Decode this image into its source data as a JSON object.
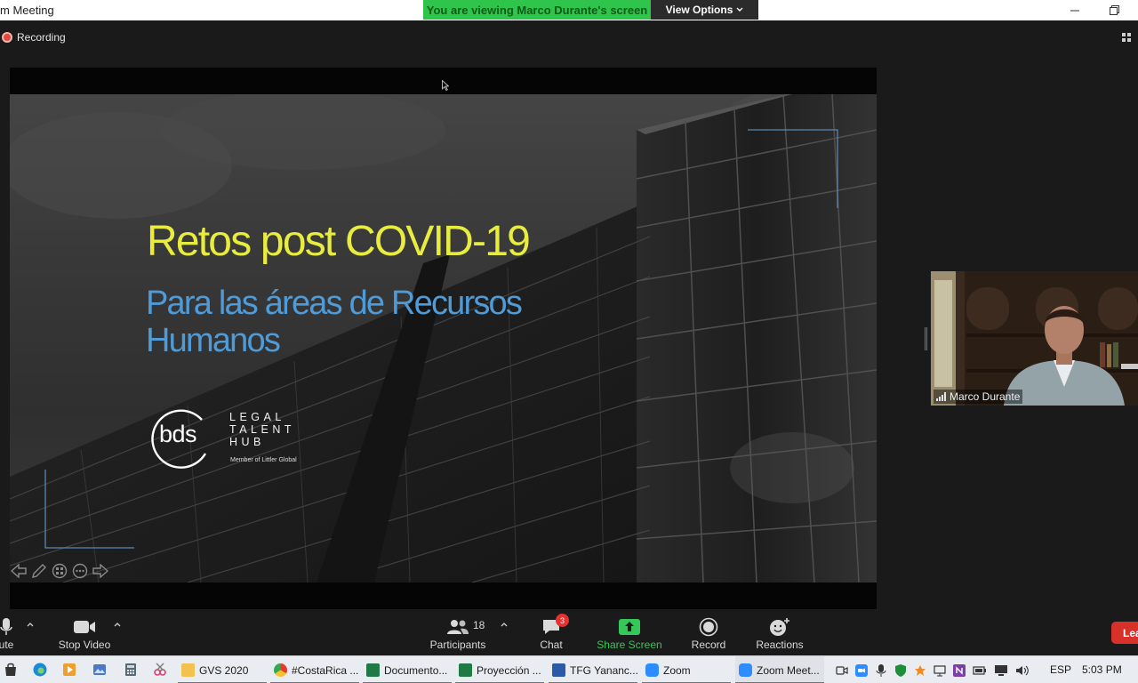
{
  "window": {
    "title": "m Meeting",
    "viewing_banner": "You are viewing Marco Durante's screen",
    "view_options": "View Options"
  },
  "recording": {
    "label": "Recording"
  },
  "slide": {
    "title": "Retos post COVID-19",
    "subtitle": "Para las áreas de Recursos Humanos",
    "logo": {
      "mark": "bds",
      "line1": "LEGAL",
      "line2": "TALENT",
      "line3": "HUB",
      "member": "Member of Littler Global"
    },
    "colors": {
      "title": "#e7ec3f",
      "subtitle": "#4f9bd8"
    }
  },
  "participant_video": {
    "name": "Marco Durante"
  },
  "toolbar": {
    "mute": "ute",
    "stop_video": "Stop Video",
    "participants": "Participants",
    "participants_count": "18",
    "chat": "Chat",
    "chat_badge": "3",
    "share_screen": "Share Screen",
    "record": "Record",
    "reactions": "Reactions",
    "leave": "Lea"
  },
  "taskbar": {
    "apps": [
      {
        "label": "GVS 2020",
        "icon": "folder-icon"
      },
      {
        "label": "#CostaRica ...",
        "icon": "chrome-icon"
      },
      {
        "label": "Documento...",
        "icon": "excel-icon"
      },
      {
        "label": "Proyección ...",
        "icon": "excel-icon"
      },
      {
        "label": "TFG Yananc...",
        "icon": "word-icon"
      },
      {
        "label": "Zoom",
        "icon": "zoom-icon"
      },
      {
        "label": "Zoom Meet...",
        "icon": "zoom-icon"
      }
    ],
    "language": "ESP",
    "clock": "5:03 PM"
  },
  "colors": {
    "accent_green": "#2fc54d",
    "leave_red": "#d8312a",
    "record_red": "#e24a3b"
  }
}
